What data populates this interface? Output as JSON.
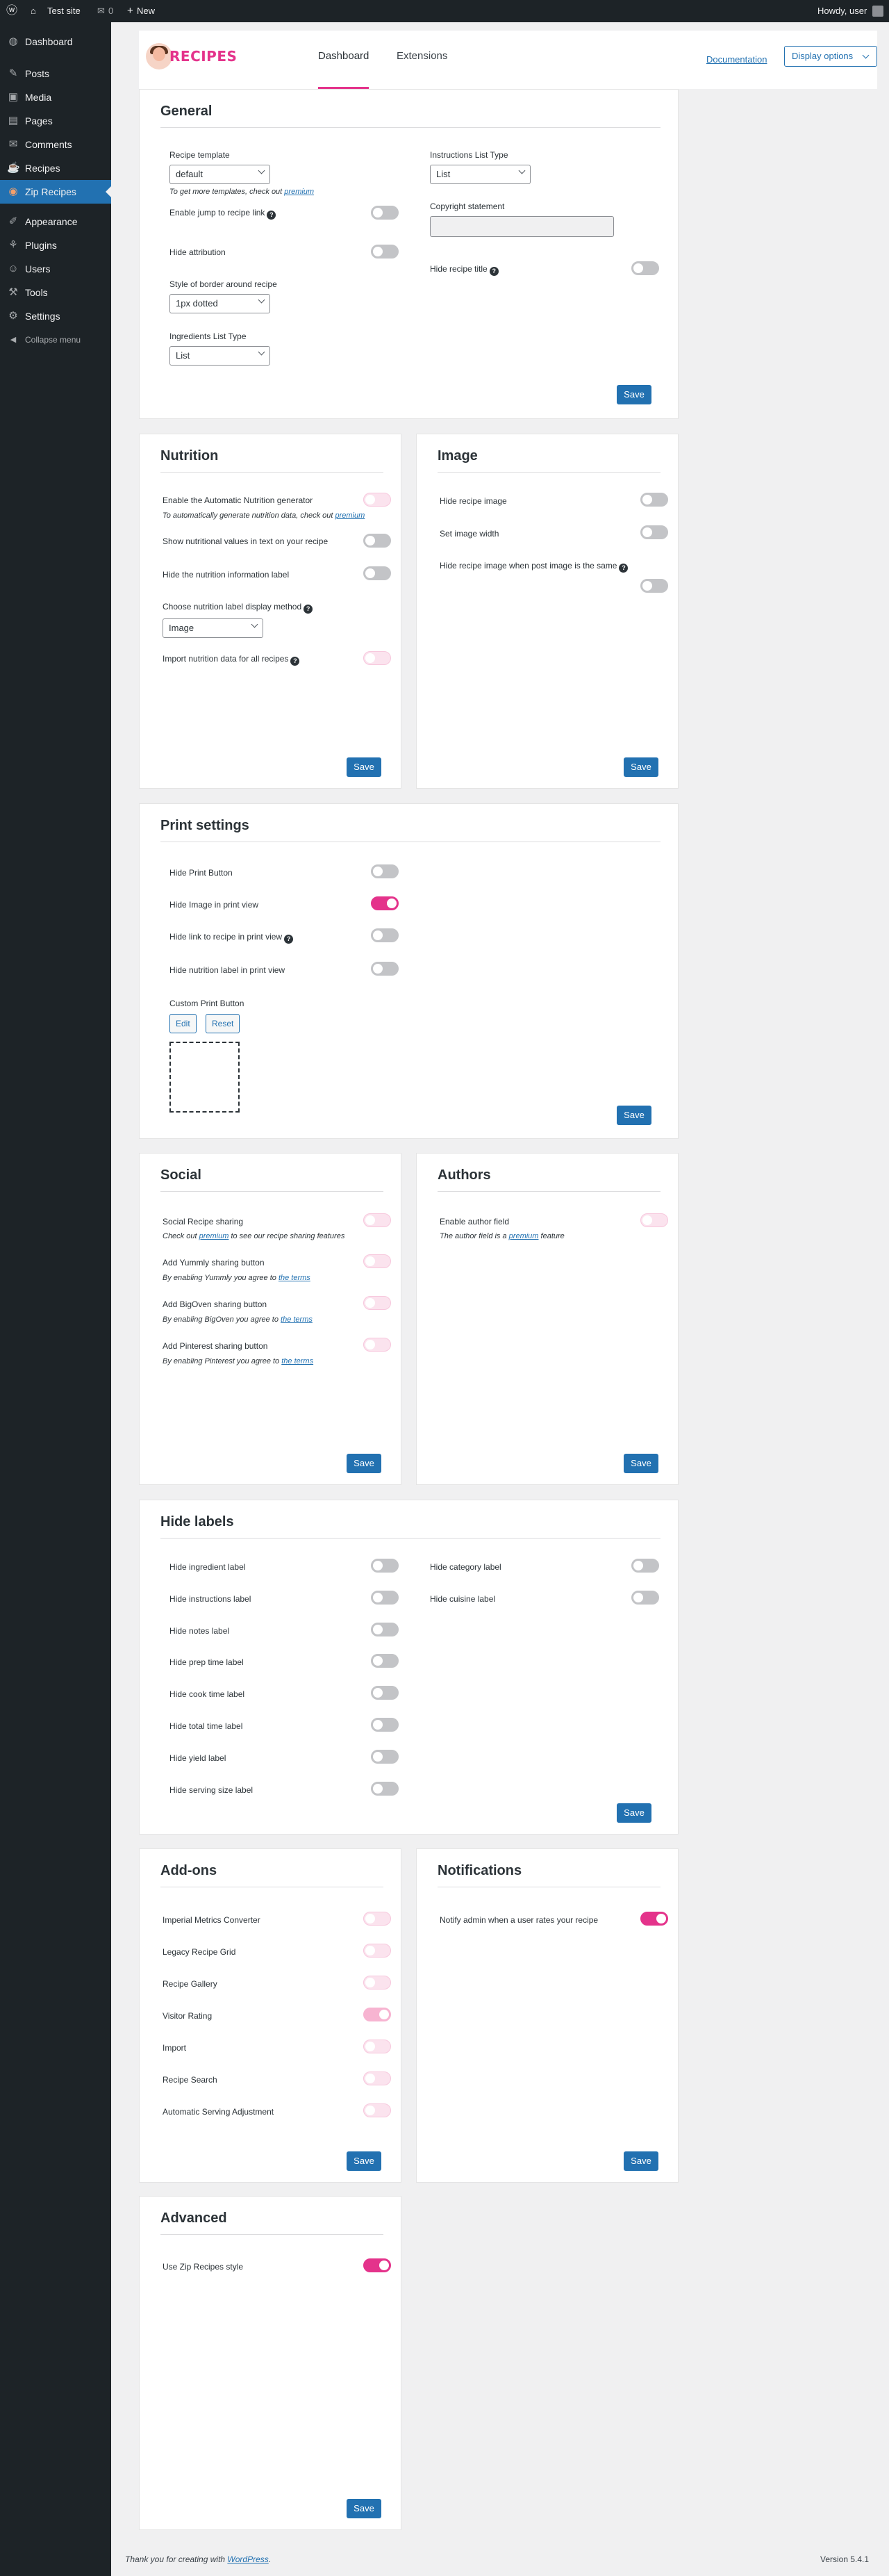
{
  "adminbar": {
    "site": "Test site",
    "comments": "0",
    "new": "New",
    "howdy": "Howdy, user"
  },
  "menu": {
    "items": [
      {
        "icon": "dashboard-icon",
        "glyph": "◍",
        "label": "Dashboard"
      },
      {
        "icon": "posts-icon",
        "glyph": "✎",
        "label": "Posts"
      },
      {
        "icon": "media-icon",
        "glyph": "▣",
        "label": "Media"
      },
      {
        "icon": "pages-icon",
        "glyph": "▤",
        "label": "Pages"
      },
      {
        "icon": "comments-icon",
        "glyph": "✉",
        "label": "Comments"
      },
      {
        "icon": "recipes-icon",
        "glyph": "☕",
        "label": "Recipes"
      },
      {
        "icon": "zip-recipes-icon",
        "glyph": "◉",
        "label": "Zip Recipes"
      },
      {
        "icon": "appearance-icon",
        "glyph": "✐",
        "label": "Appearance"
      },
      {
        "icon": "plugins-icon",
        "glyph": "⚘",
        "label": "Plugins"
      },
      {
        "icon": "users-icon",
        "glyph": "☺",
        "label": "Users"
      },
      {
        "icon": "tools-icon",
        "glyph": "⚒",
        "label": "Tools"
      },
      {
        "icon": "settings-icon",
        "glyph": "⚙",
        "label": "Settings"
      },
      {
        "icon": "collapse-icon",
        "glyph": "◀",
        "label": "Collapse menu"
      }
    ]
  },
  "header": {
    "logo_text": "RECIPES",
    "tab_dashboard": "Dashboard",
    "tab_extensions": "Extensions",
    "documentation": "Documentation",
    "display_options": "Display options"
  },
  "general": {
    "title": "General",
    "recipe_template_label": "Recipe template",
    "recipe_template_value": "default",
    "templates_note": "To get more templates, check out ",
    "premium": "premium",
    "jump_label": "Enable jump to recipe link",
    "hide_attribution": "Hide attribution",
    "border_label": "Style of border around recipe",
    "border_value": "1px dotted",
    "ingredients_type_label": "Ingredients List Type",
    "ingredients_type_value": "List",
    "instructions_type_label": "Instructions List Type",
    "instructions_type_value": "List",
    "copyright_label": "Copyright statement",
    "hide_title_label": "Hide recipe title",
    "save": "Save"
  },
  "nutrition": {
    "title": "Nutrition",
    "auto_label": "Enable the Automatic Nutrition generator",
    "auto_note": "To automatically generate nutrition data, check out ",
    "premium": "premium",
    "show_text": "Show nutritional values in text on your recipe",
    "hide_info": "Hide the nutrition information label",
    "method_label": "Choose nutrition label display method",
    "method_value": "Image",
    "import_label": "Import nutrition data for all recipes",
    "save": "Save"
  },
  "image": {
    "title": "Image",
    "hide_image": "Hide recipe image",
    "set_width": "Set image width",
    "hide_when_post": "Hide recipe image when post image is the same",
    "save": "Save"
  },
  "print": {
    "title": "Print settings",
    "hide_print_button": "Hide Print Button",
    "hide_image_print": "Hide Image in print view",
    "hide_link_print": "Hide link to recipe in print view",
    "hide_nutrition_print": "Hide nutrition label in print view",
    "custom_print_button": "Custom Print Button",
    "edit": "Edit",
    "reset": "Reset",
    "save": "Save"
  },
  "social": {
    "title": "Social",
    "sharing_label": "Social Recipe sharing",
    "sharing_note_a": "Check out ",
    "premium": "premium",
    "sharing_note_b": " to see our recipe sharing features",
    "yummly_label": "Add Yummly sharing button",
    "yummly_note": "By enabling Yummly you agree to ",
    "bigoven_label": "Add BigOven sharing button",
    "bigoven_note": "By enabling BigOven you agree to ",
    "pinterest_label": "Add Pinterest sharing button",
    "pinterest_note": "By enabling Pinterest you agree to ",
    "the_terms": "the terms",
    "save": "Save"
  },
  "authors": {
    "title": "Authors",
    "enable_label": "Enable author field",
    "note_a": "The author field is a ",
    "premium": "premium",
    "note_b": " feature",
    "save": "Save"
  },
  "hide_labels": {
    "title": "Hide labels",
    "left": [
      "Hide ingredient label",
      "Hide instructions label",
      "Hide notes label",
      "Hide prep time label",
      "Hide cook time label",
      "Hide total time label",
      "Hide yield label",
      "Hide serving size label"
    ],
    "right": [
      "Hide category label",
      "Hide cuisine label"
    ],
    "save": "Save"
  },
  "addons": {
    "title": "Add-ons",
    "items": [
      "Imperial Metrics Converter",
      "Legacy Recipe Grid",
      "Recipe Gallery",
      "Visitor Rating",
      "Import",
      "Recipe Search",
      "Automatic Serving Adjustment"
    ],
    "save": "Save"
  },
  "notifications": {
    "title": "Notifications",
    "notify_label": "Notify admin when a user rates your recipe",
    "save": "Save"
  },
  "advanced": {
    "title": "Advanced",
    "use_style": "Use Zip Recipes style",
    "save": "Save"
  },
  "footer": {
    "thanks": "Thank you for creating with ",
    "wordpress": "WordPress",
    "version": "Version 5.4.1"
  },
  "colors": {
    "accent": "#e4338b",
    "wp_blue": "#2271b1",
    "admin_dark": "#1d2327"
  }
}
